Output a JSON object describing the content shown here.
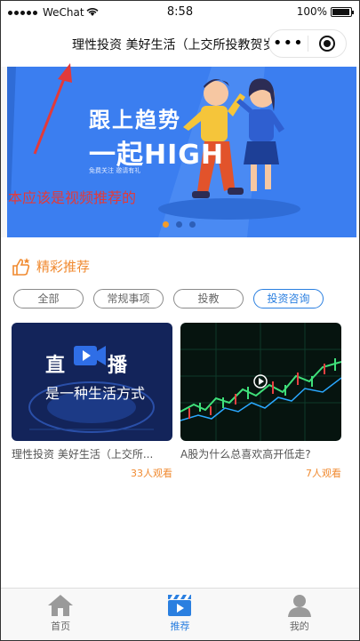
{
  "status_bar": {
    "carrier": "WeChat",
    "time": "8:58",
    "battery": "100%"
  },
  "navbar": {
    "title": "理性投资 美好生活（上交所投教贺岁",
    "menu_icon": "more-dots-icon",
    "close_icon": "target-close-icon"
  },
  "banner": {
    "headline_1": "跟上趋势",
    "headline_2": "一起HIGH",
    "subline": "免费关注  邀请有礼",
    "annotation": "本应该是视频推荐的",
    "indicator_count": 3,
    "indicator_active": 0
  },
  "section": {
    "title": "精彩推荐",
    "icon": "thumbs-up-icon",
    "tags": [
      {
        "label": "全部",
        "active": false
      },
      {
        "label": "常规事项",
        "active": false
      },
      {
        "label": "投教",
        "active": false
      },
      {
        "label": "投资咨询",
        "active": true
      }
    ],
    "cards": [
      {
        "title": "理性投资 美好生活（上交所...",
        "views": "33人观看",
        "thumb_text_1": "直",
        "thumb_text_2": "播",
        "thumb_text_3": "是一种生活方式"
      },
      {
        "title": "A股为什么总喜欢高开低走?",
        "views": "7人观看"
      }
    ]
  },
  "tabbar": {
    "items": [
      {
        "label": "首页",
        "icon": "home-icon",
        "active": false
      },
      {
        "label": "推荐",
        "icon": "video-clapper-icon",
        "active": true
      },
      {
        "label": "我的",
        "icon": "user-icon",
        "active": false
      }
    ]
  },
  "colors": {
    "accent_orange": "#f08a30",
    "accent_blue": "#2a7fe0",
    "banner_blue": "#3b7ef0",
    "annotation_red": "#e23a3a"
  }
}
